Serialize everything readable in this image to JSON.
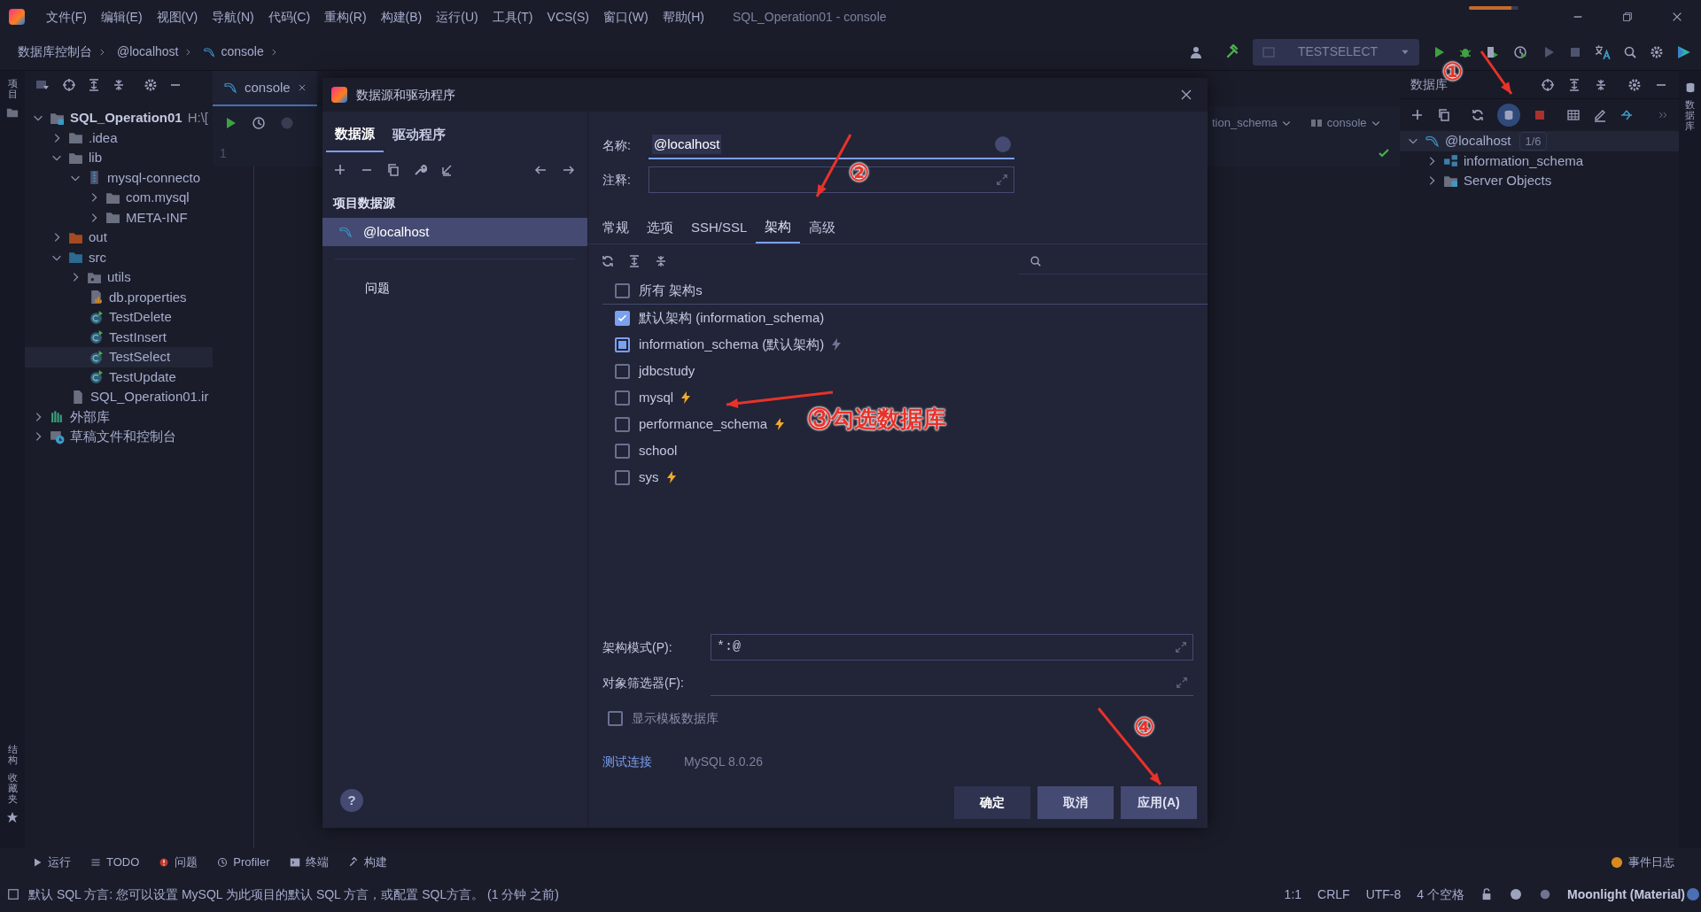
{
  "menu_bar": {
    "progress": {
      "level": 0.85
    },
    "items": [
      "文件(F)",
      "编辑(E)",
      "视图(V)",
      "导航(N)",
      "代码(C)",
      "重构(R)",
      "构建(B)",
      "运行(U)",
      "工具(T)",
      "VCS(S)",
      "窗口(W)",
      "帮助(H)"
    ],
    "title": "SQL_Operation01 - console"
  },
  "navigation_bar": {
    "breadcrumbs": [
      "数据库控制台",
      "@localhost",
      "console"
    ],
    "run_config": "TESTSELECT"
  },
  "left_stripe": {
    "top": [
      "项目"
    ],
    "bottom": [
      "结构",
      "收藏夹"
    ]
  },
  "project_panel": {
    "tree": [
      {
        "label": "SQL_Operation01",
        "detail": "H:\\[",
        "kind": "project",
        "expanded": true,
        "selected": false,
        "children": [
          {
            "label": ".idea",
            "kind": "folder",
            "expanded": false,
            "selected": false
          },
          {
            "label": "lib",
            "kind": "folder",
            "expanded": true,
            "selected": false,
            "children": [
              {
                "label": "mysql-connecto",
                "kind": "jar",
                "expanded": true,
                "selected": false,
                "children": [
                  {
                    "label": "com.mysql",
                    "kind": "folder",
                    "expanded": false,
                    "selected": false
                  },
                  {
                    "label": "META-INF",
                    "kind": "folder",
                    "expanded": false,
                    "selected": false
                  }
                ]
              }
            ]
          },
          {
            "label": "out",
            "kind": "excluded",
            "expanded": false,
            "selected": false
          },
          {
            "label": "src",
            "kind": "source",
            "expanded": true,
            "selected": false,
            "children": [
              {
                "label": "utils",
                "kind": "package",
                "expanded": false,
                "selected": false
              },
              {
                "label": "db.properties",
                "kind": "properties",
                "selected": false
              },
              {
                "label": "TestDelete",
                "kind": "class",
                "selected": false
              },
              {
                "label": "TestInsert",
                "kind": "class",
                "selected": false
              },
              {
                "label": "TestSelect",
                "kind": "class",
                "selected": true
              },
              {
                "label": "TestUpdate",
                "kind": "class",
                "selected": false
              }
            ]
          },
          {
            "label": "SQL_Operation01.ir",
            "kind": "module",
            "selected": false
          }
        ]
      },
      {
        "label": "外部库",
        "kind": "library",
        "expanded": false,
        "selected": false
      },
      {
        "label": "草稿文件和控制台",
        "kind": "scratches",
        "expanded": false,
        "selected": false
      }
    ]
  },
  "editor": {
    "tab": {
      "label": "console",
      "selected": true
    },
    "gutter": [
      "1"
    ],
    "schema": "tion_schema",
    "session": "console"
  },
  "database_panel": {
    "title": "数据库",
    "tree": [
      {
        "label": "@localhost",
        "badge": "1/6",
        "kind": "connection",
        "expanded": true,
        "selected": true,
        "children": [
          {
            "label": "information_schema",
            "kind": "schema",
            "expanded": false,
            "selected": false
          },
          {
            "label": "Server Objects",
            "kind": "server-objects",
            "expanded": false,
            "selected": false
          }
        ]
      }
    ]
  },
  "right_stripe": {
    "label": "数据库"
  },
  "dialog": {
    "title": "数据源和驱动程序",
    "left_tabs": [
      {
        "label": "数据源",
        "selected": true
      },
      {
        "label": "驱动程序",
        "selected": false
      }
    ],
    "section": "项目数据源",
    "data_sources": [
      {
        "label": "@localhost",
        "selected": true
      }
    ],
    "problems": "问题",
    "name_label": "名称:",
    "name_value": "@localhost",
    "comment_label": "注释:",
    "tabs": [
      {
        "label": "常规",
        "selected": false
      },
      {
        "label": "选项",
        "selected": false
      },
      {
        "label": "SSH/SSL",
        "selected": false
      },
      {
        "label": "架构",
        "selected": true
      },
      {
        "label": "高级",
        "selected": false
      }
    ],
    "schemas": [
      {
        "label": "所有 架构s",
        "checked": false,
        "mixed": false,
        "header": true
      },
      {
        "label": "默认架构 (information_schema)",
        "checked": true,
        "mixed": false,
        "header": false
      },
      {
        "label": "information_schema (默认架构)",
        "checked": false,
        "mixed": true,
        "header": false,
        "color": "#6f7492"
      },
      {
        "label": "jdbcstudy",
        "checked": false,
        "mixed": false,
        "header": false
      },
      {
        "label": "mysql",
        "checked": false,
        "mixed": false,
        "header": false,
        "color": "#f0a92a"
      },
      {
        "label": "performance_schema",
        "checked": false,
        "mixed": false,
        "header": false,
        "color": "#f0a92a"
      },
      {
        "label": "school",
        "checked": false,
        "mixed": false,
        "header": false
      },
      {
        "label": "sys",
        "checked": false,
        "mixed": false,
        "header": false,
        "color": "#f0a92a"
      }
    ],
    "schema_pattern_label": "架构模式(P):",
    "schema_pattern_value": "*:@",
    "object_filter_label": "对象筛选器(F):",
    "template_checkbox": {
      "label": "显示模板数据库",
      "checked": false
    },
    "test_link": "测试连接",
    "driver_version": "MySQL 8.0.26",
    "help": "?",
    "buttons": [
      {
        "label": "确定",
        "kind": "default"
      },
      {
        "label": "取消",
        "kind": "normal"
      },
      {
        "label": "应用(A)",
        "kind": "normal"
      }
    ]
  },
  "tool_window_bar": {
    "items": [
      "运行",
      "TODO",
      "问题",
      "Profiler",
      "终端",
      "构建"
    ],
    "event_log": "事件日志"
  },
  "status_bar": {
    "message": "默认 SQL 方言: 您可以设置 MySQL 为此项目的默认 SQL 方言，或配置 SQL方言。 (1 分钟 之前)",
    "items": [
      "1:1",
      "CRLF",
      "UTF-8",
      "4 个空格"
    ],
    "theme": "Moonlight (Material)"
  },
  "annotations": [
    "①",
    "②",
    "③勾选数据库",
    "④"
  ]
}
